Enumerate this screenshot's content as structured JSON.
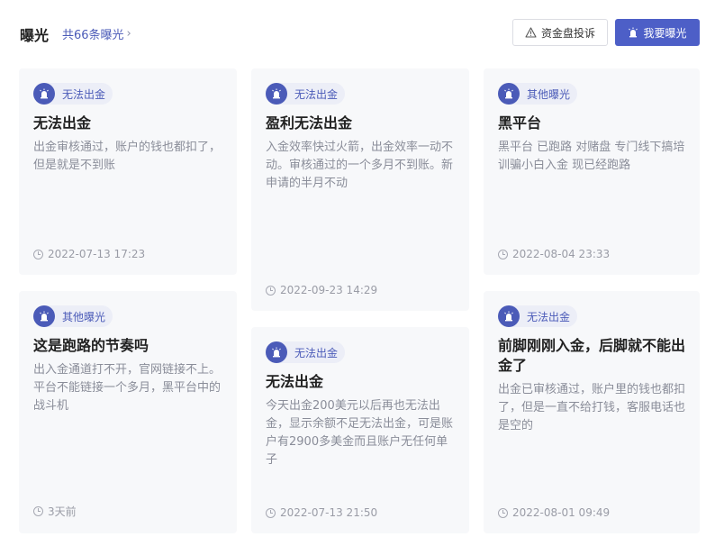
{
  "header": {
    "title": "曝光",
    "count_link": "共66条曝光",
    "complaint_button": "资金盘投诉",
    "expose_button": "我要曝光"
  },
  "cards": [
    {
      "tag": "无法出金",
      "title": "无法出金",
      "body": "出金审核通过，账户的钱也都扣了，但是就是不到账",
      "time": "2022-07-13 17:23"
    },
    {
      "tag": "其他曝光",
      "title": "这是跑路的节奏吗",
      "body": "出入金通道打不开，官网链接不上。平台不能链接一个多月，黑平台中的战斗机",
      "time": "3天前"
    },
    {
      "tag": "无法出金",
      "title": "盈利无法出金",
      "body": "入金效率快过火箭，出金效率一动不动。审核通过的一个多月不到账。新申请的半月不动",
      "time": "2022-09-23 14:29"
    },
    {
      "tag": "无法出金",
      "title": "无法出金",
      "body": "今天出金200美元以后再也无法出金，显示余额不足无法出金，可是账户有2900多美金而且账户无任何单子",
      "time": "2022-07-13 21:50"
    },
    {
      "tag": "其他曝光",
      "title": "黑平台",
      "body": "黑平台 已跑路 对赌盘 专门线下搞培训骗小白入金 现已经跑路",
      "time": "2022-08-04 23:33"
    },
    {
      "tag": "无法出金",
      "title": "前脚刚刚入金，后脚就不能出金了",
      "body": "出金已审核通过，账户里的钱也都扣了，但是一直不给打钱，客服电话也是空的",
      "time": "2022-08-01 09:49"
    }
  ]
}
